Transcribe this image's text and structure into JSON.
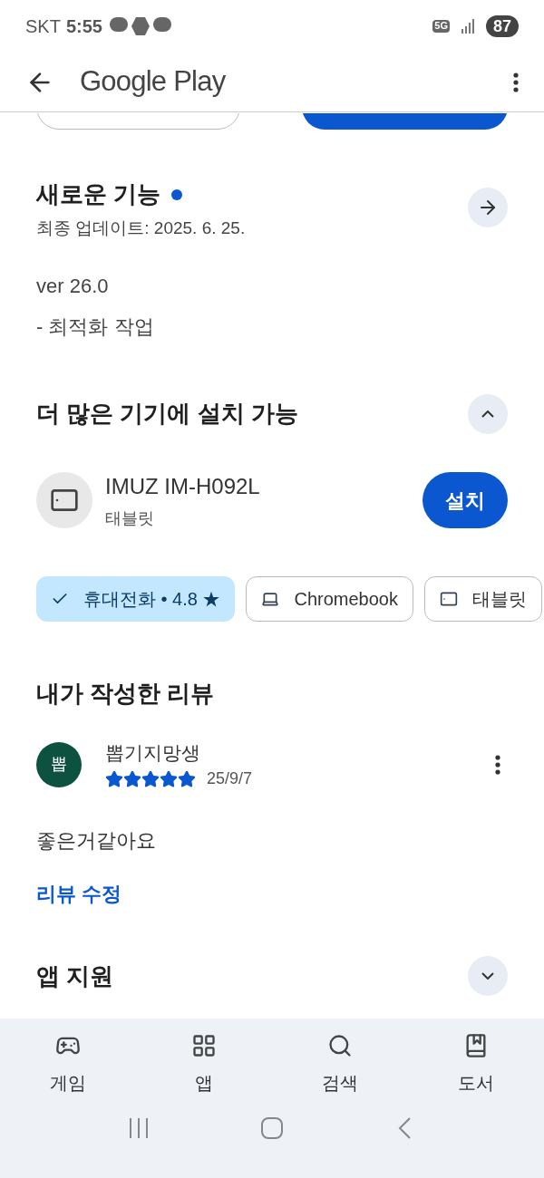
{
  "status_bar": {
    "carrier": "SKT",
    "time": "5:55",
    "network": "5G",
    "battery": "87"
  },
  "app_bar": {
    "title": "Google Play"
  },
  "whats_new": {
    "title": "새로운 기능",
    "new_dot": true,
    "updated": "최종 업데이트: 2025. 6. 25.",
    "notes": [
      "ver 26.0",
      "- 최적화 작업"
    ]
  },
  "more_devices": {
    "title": "더 많은 기기에 설치 가능",
    "expanded": true,
    "device": {
      "name": "IMUZ IM-H092L",
      "type": "태블릿",
      "button": "설치"
    },
    "chips": [
      {
        "kind": "phone",
        "label": "휴대전화 • 4.8 ★",
        "selected": true
      },
      {
        "kind": "laptop",
        "label": "Chromebook",
        "selected": false
      },
      {
        "kind": "tablet",
        "label": "태블릿",
        "selected": false
      }
    ]
  },
  "my_review": {
    "title": "내가 작성한 리뷰",
    "avatar": "뽑",
    "author": "뽑기지망생",
    "stars": 5,
    "date": "25/9/7",
    "text": "좋은거같아요",
    "edit_link": "리뷰 수정"
  },
  "app_support": {
    "title": "앱 지원",
    "expanded": false
  },
  "bottom_nav": [
    {
      "kind": "games",
      "label": "게임"
    },
    {
      "kind": "apps",
      "label": "앱"
    },
    {
      "kind": "search",
      "label": "검색"
    },
    {
      "kind": "books",
      "label": "도서"
    }
  ]
}
